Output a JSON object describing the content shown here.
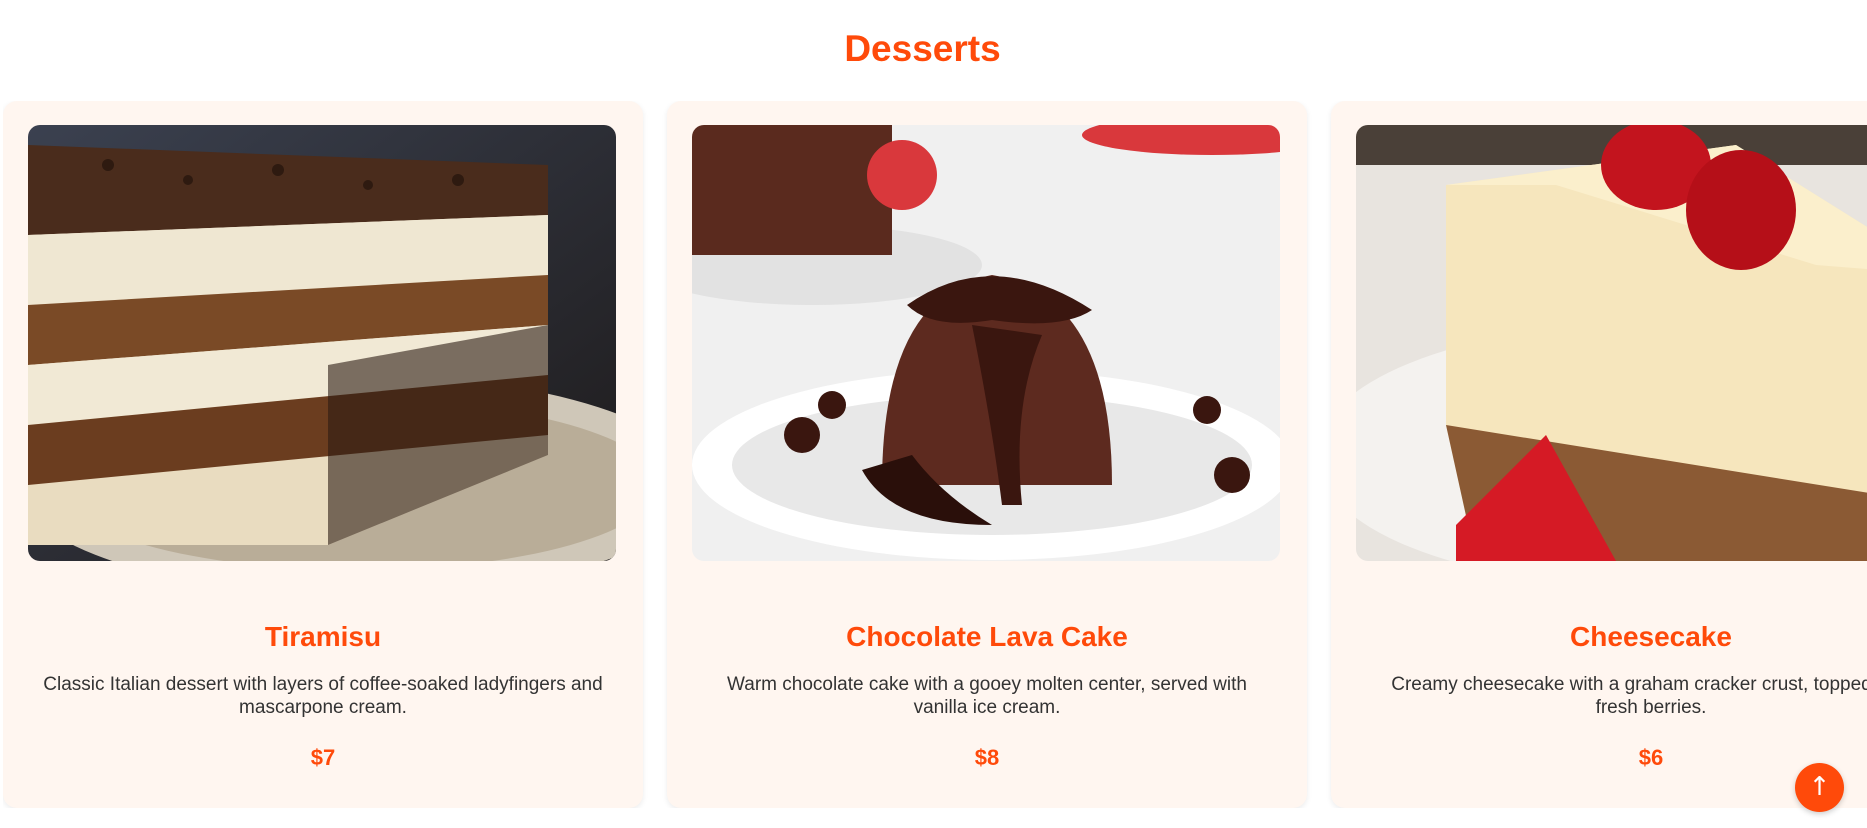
{
  "section": {
    "title": "Desserts"
  },
  "desserts": [
    {
      "name": "Tiramisu",
      "description": "Classic Italian dessert with layers of coffee-soaked ladyfingers and mascarpone cream.",
      "price": "$7",
      "image_subject": "tiramisu-photo"
    },
    {
      "name": "Chocolate Lava Cake",
      "description": "Warm chocolate cake with a gooey molten center, served with vanilla ice cream.",
      "price": "$8",
      "image_subject": "chocolate-lava-cake-photo"
    },
    {
      "name": "Cheesecake",
      "description": "Creamy cheesecake with a graham cracker crust, topped with fresh berries.",
      "price": "$6",
      "image_subject": "cheesecake-photo"
    }
  ],
  "scroll_top": {
    "label": "↑"
  },
  "colors": {
    "accent": "#ff4a0a",
    "card_background": "#fff6f0",
    "body_text": "#333333"
  }
}
